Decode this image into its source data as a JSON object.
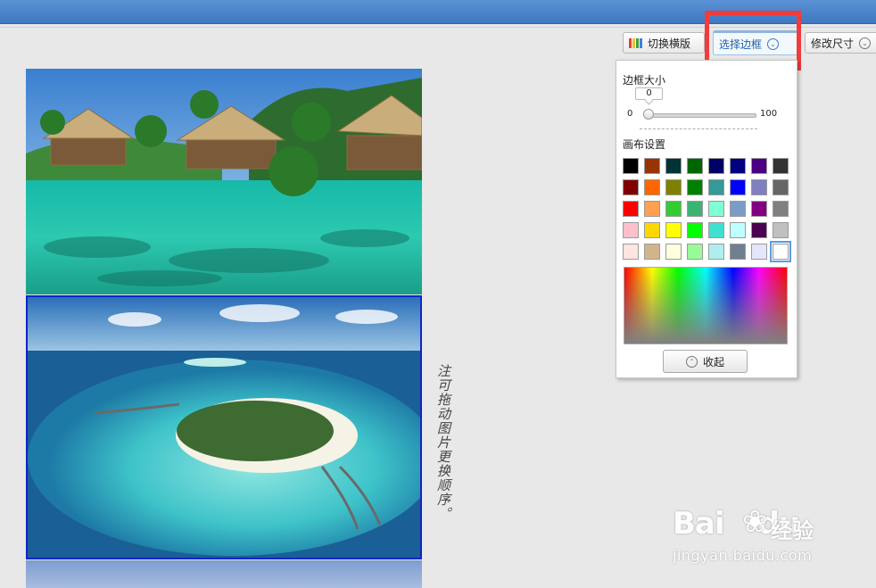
{
  "toolbar": {
    "switch_layout_label": "切换横版",
    "select_border_label": "选择边框",
    "resize_label": "修改尺寸",
    "palette_colors": [
      "#e84040",
      "#f0c030",
      "#40a040",
      "#4080e0"
    ]
  },
  "border_panel": {
    "border_size_label": "边框大小",
    "border_size_value": "0",
    "slider_min": "0",
    "slider_max": "100",
    "slider_level_fraction": 0,
    "canvas_settings_label": "画布设置",
    "swatches": [
      "#000000",
      "#993300",
      "#003333",
      "#006600",
      "#000066",
      "#000080",
      "#4b0082",
      "#333333",
      "#800000",
      "#ff6600",
      "#808000",
      "#008000",
      "#339999",
      "#0000ff",
      "#8080c0",
      "#666666",
      "#ff0000",
      "#ffa050",
      "#33cc33",
      "#3cb371",
      "#7fffd4",
      "#7b9cc6",
      "#800080",
      "#808080",
      "#ffc0cb",
      "#ffd700",
      "#ffff00",
      "#00ff00",
      "#40e0d0",
      "#c0ffff",
      "#4b0050",
      "#c0c0c0",
      "#ffe4e1",
      "#d2b48c",
      "#ffffe0",
      "#98fb98",
      "#afeeee",
      "#708090",
      "#e6e6fa",
      "#ffffff"
    ],
    "selected_swatch_index": 39,
    "collapse_label": "收起"
  },
  "canvas": {
    "side_note": "注可拖动图片更换顺序。"
  },
  "watermark": {
    "brand": "Bai",
    "brand_suffix": "du",
    "label": "经验",
    "url": "jingyan.baidu.com"
  }
}
